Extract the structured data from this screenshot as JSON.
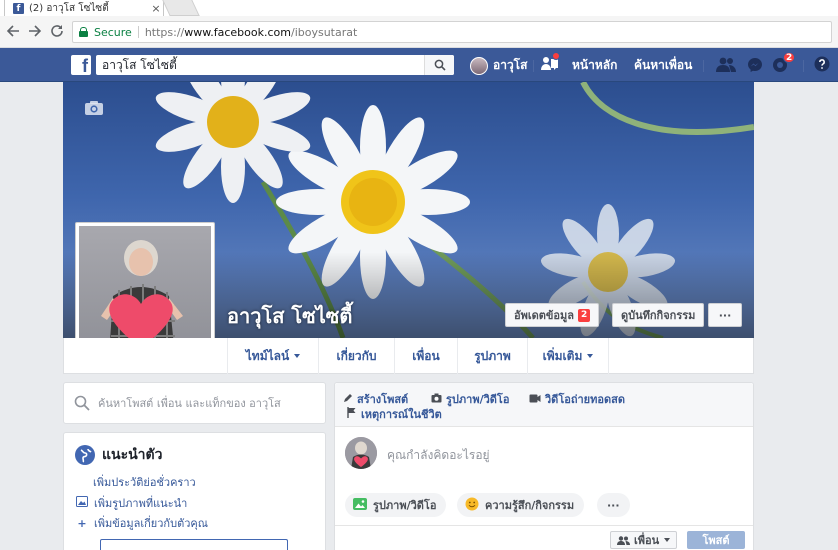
{
  "browser": {
    "tab_title": "(2) อาวุโส โซไซตี้",
    "tab_close": "×",
    "secure_label": "Secure",
    "url_scheme": "https://",
    "url_host": "www.facebook.com",
    "url_path": "/iboysutarat"
  },
  "fb_header": {
    "search_value": "อาวุโส โซไซตี้",
    "user_name": "อาวุโส",
    "home": "หน้าหลัก",
    "find_friends": "ค้นหาเพื่อน",
    "notif_count": "2"
  },
  "profile": {
    "name": "อาวุโส โซไซตี้",
    "update_info": "อัพเดตข้อมูล",
    "update_badge": "2",
    "activity_log": "ดูบันทึกกิจกรรม",
    "more": "···"
  },
  "tabs": [
    {
      "label": "ไทม์ไลน์"
    },
    {
      "label": "เกี่ยวกับ"
    },
    {
      "label": "เพื่อน"
    },
    {
      "label": "รูปภาพ"
    },
    {
      "label": "เพิ่มเติม"
    }
  ],
  "left": {
    "search_placeholder": "ค้นหาโพสต์ เพื่อน และแท็กของ อาวุโส",
    "intro_title": "แนะนำตัว",
    "links": [
      "เพิ่มประวัติย่อชั่วคราว",
      "เพิ่มรูปภาพที่แนะนำ",
      "เพิ่มข้อมูลเกี่ยวกับตัวคุณ"
    ]
  },
  "composer": {
    "create_post": "สร้างโพสต์",
    "photo_video": "รูปภาพ/วิดีโอ",
    "live_video": "วิดีโอถ่ายทอดสด",
    "life_event": "เหตุการณ์ในชีวิต",
    "placeholder": "คุณกำลังคิดอะไรอยู่",
    "pill_photo": "รูปภาพ/วิดีโอ",
    "pill_feeling": "ความรู้สึก/กิจกรรม",
    "pill_more": "···",
    "audience": "เพื่อน",
    "post": "โพสต์"
  },
  "colors": {
    "fb_blue": "#3b5998",
    "link_blue": "#365899",
    "badge_red": "#fa3e3e",
    "secure_green": "#0b8043"
  }
}
